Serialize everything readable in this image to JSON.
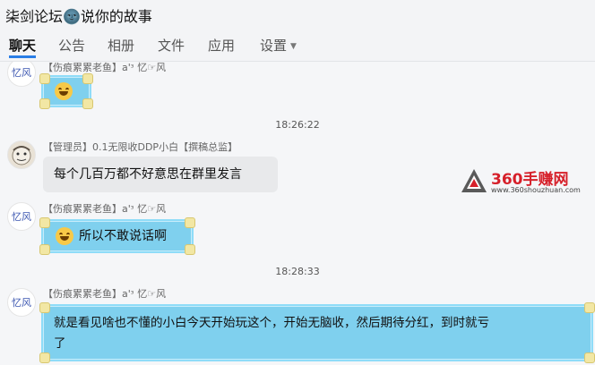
{
  "window": {
    "title": "柒剑论坛🌚说你的故事"
  },
  "tabs": [
    {
      "label": "聊天",
      "active": true
    },
    {
      "label": "公告"
    },
    {
      "label": "相册"
    },
    {
      "label": "文件"
    },
    {
      "label": "应用"
    },
    {
      "label": "设置"
    }
  ],
  "messages": [
    {
      "avatar_text": "忆风",
      "sender": "【伤痕累累老鱼】a'ᵌ 忆☞风",
      "content": ""
    },
    {
      "timestamp": "18:26:22"
    },
    {
      "avatar_text": "",
      "sender": "【管理员】0.1无限收DDP小白【撰稿总监】",
      "content": "每个几百万都不好意思在群里发言"
    },
    {
      "avatar_text": "忆风",
      "sender": "【伤痕累累老鱼】a'ᵌ 忆☞风",
      "content": "所以不敢说话啊"
    },
    {
      "timestamp": "18:28:33"
    },
    {
      "avatar_text": "忆风",
      "sender": "【伤痕累累老鱼】a'ᵌ 忆☞风",
      "content_line1": "就是看见啥也不懂的小白今天开始玩这个，开始无脑收，然后期待分红，到时就亏",
      "content_line2": "了"
    }
  ],
  "watermark": {
    "brand": "360手赚网",
    "url": "www.360shouzhuan.com"
  },
  "colors": {
    "accent": "#2a7ee6",
    "bubble_blue": "#7fd0ee",
    "bubble_gray": "#e8e9eb"
  }
}
